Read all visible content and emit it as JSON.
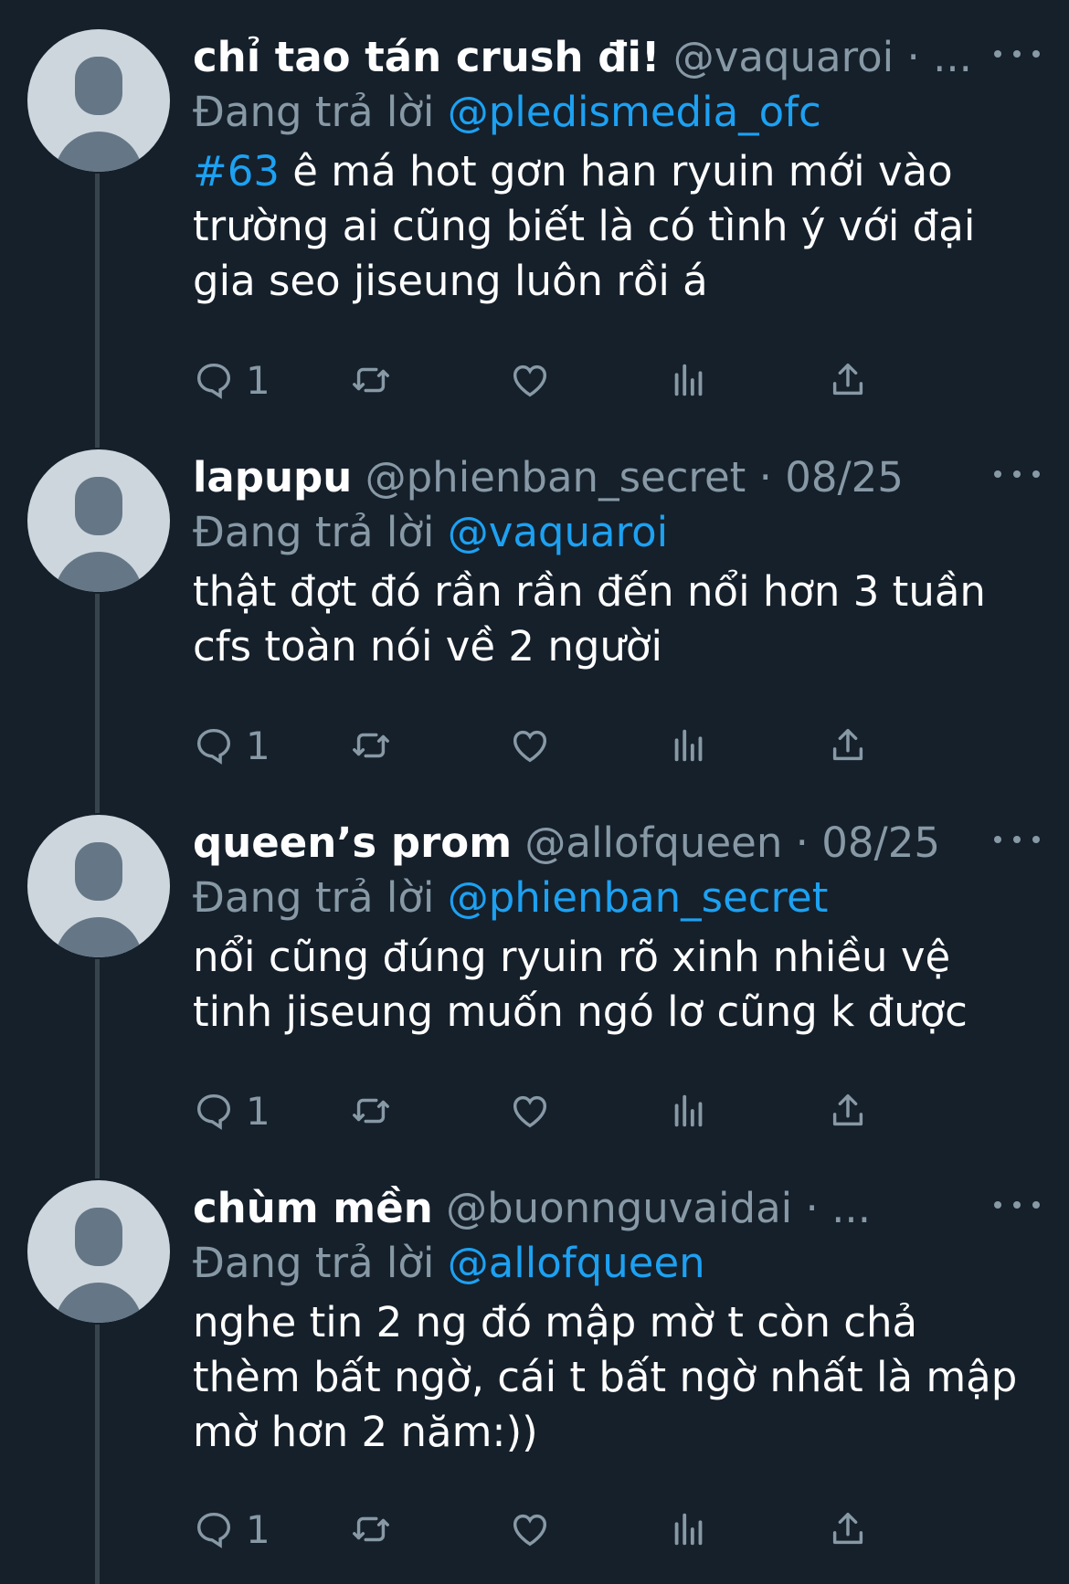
{
  "colors": {
    "background": "#15202b",
    "text_primary": "#ffffff",
    "text_secondary": "#8899a6",
    "accent": "#1da1f2",
    "thread_line": "#38444d",
    "avatar_bg": "#cdd6dd",
    "avatar_fg": "#657786"
  },
  "icons": {
    "reply": "speech-bubble-icon",
    "retweet": "retweet-arrows-icon",
    "like": "heart-icon",
    "analytics": "bar-chart-icon",
    "share": "share-upload-icon",
    "more": "three-dots-icon",
    "avatar": "default-user-avatar"
  },
  "tweets": [
    {
      "display_name": "chỉ tao tán crush đi!",
      "handle": "@vaquaroi",
      "separator": "·",
      "date": "",
      "ellipsis": "...",
      "reply_prefix": "Đang trả lời",
      "reply_to": "@pledismedia_ofc",
      "hashtag": "#63",
      "text": " ê má hot gơn han ryuin mới vào trường ai cũng biết là có tình ý với đại gia seo jiseung luôn rồi á",
      "reply_count": "1"
    },
    {
      "display_name": "lapupu",
      "handle": "@phienban_secret",
      "separator": "·",
      "date": "08/25",
      "ellipsis": "",
      "reply_prefix": "Đang trả lời",
      "reply_to": "@vaquaroi",
      "hashtag": "",
      "text": "thật đợt đó rần rần đến nổi hơn 3 tuần cfs toàn nói về 2 người",
      "reply_count": "1"
    },
    {
      "display_name": "queen’s prom",
      "handle": "@allofqueen",
      "separator": "·",
      "date": "08/25",
      "ellipsis": "",
      "reply_prefix": "Đang trả lời",
      "reply_to": "@phienban_secret",
      "hashtag": "",
      "text": "nổi cũng đúng ryuin rõ xinh nhiều vệ tinh jiseung muốn ngó lơ cũng k được",
      "reply_count": "1"
    },
    {
      "display_name": "chùm mền",
      "handle": "@buonnguvaidai",
      "separator": "·",
      "date": "",
      "ellipsis": "...",
      "reply_prefix": "Đang trả lời",
      "reply_to": "@allofqueen",
      "hashtag": "",
      "text": "nghe tin 2 ng đó mập mờ t còn chả thèm bất ngờ, cái t bất ngờ nhất là mập mờ hơn 2 năm:))",
      "reply_count": "1"
    }
  ]
}
